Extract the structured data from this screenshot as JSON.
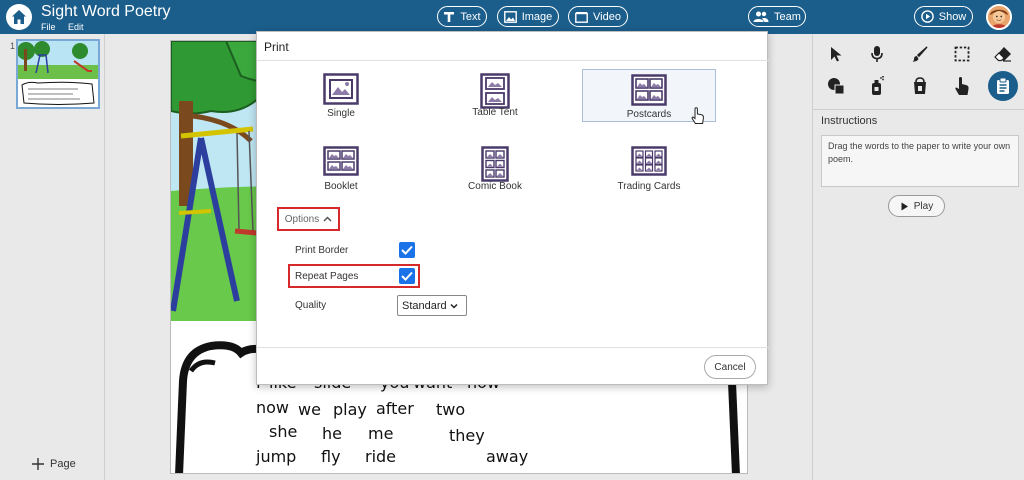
{
  "app": {
    "title": "Sight Word Poetry",
    "menu": [
      "File",
      "Edit"
    ]
  },
  "toolbar": {
    "text_label": "Text",
    "image_label": "Image",
    "video_label": "Video",
    "team_label": "Team",
    "show_label": "Show"
  },
  "pages": {
    "number": "1",
    "add_label": "Page"
  },
  "canvas": {
    "words": [
      [
        "I",
        "like",
        "slide",
        "you",
        "want",
        "now"
      ],
      [
        "now",
        "we",
        "play",
        "after",
        "two"
      ],
      [
        "she",
        "he",
        "me",
        "they"
      ],
      [
        "jump",
        "fly",
        "ride",
        "away"
      ]
    ]
  },
  "instructions": {
    "title": "Instructions",
    "text": "Drag the words to the paper to write your own poem.",
    "play_label": "Play"
  },
  "print_dialog": {
    "title": "Print",
    "layouts": [
      "Single",
      "Table Tent",
      "Postcards",
      "Booklet",
      "Comic Book",
      "Trading Cards"
    ],
    "selected_layout": "Postcards",
    "options_label": "Options",
    "print_border_label": "Print Border",
    "print_border_checked": true,
    "repeat_pages_label": "Repeat Pages",
    "repeat_pages_checked": true,
    "quality_label": "Quality",
    "quality_value": "Standard",
    "cancel_label": "Cancel"
  },
  "colors": {
    "topbar": "#1b5e8c",
    "accent": "#1a73e8",
    "highlight": "#d6292b",
    "icon_purple": "#4a3a6a"
  }
}
